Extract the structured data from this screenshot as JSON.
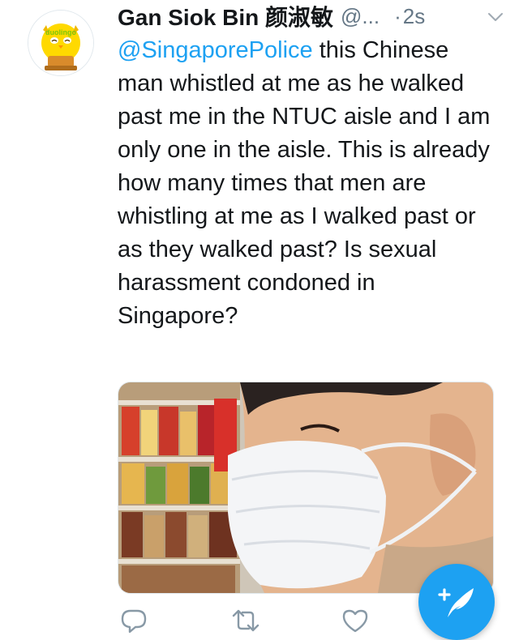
{
  "tweet": {
    "display_name": "Gan Siok Bin 颜淑敏",
    "handle": "@...",
    "dot": "·",
    "timestamp": "2s",
    "mention": "@SingaporePolice",
    "body": " this Chinese man whistled at me as he walked past me in the NTUC aisle and I am only one in the aisle. This is already how many times that men are whistling at me as I walked past or as they walked past? Is sexual harassment condoned in Singapore?"
  },
  "avatar": {
    "brand_text": "duolingo"
  },
  "icons": {
    "reply": "reply-icon",
    "retweet": "retweet-icon",
    "like": "heart-icon",
    "compose": "compose-tweet-icon",
    "caret": "chevron-down-icon"
  },
  "colors": {
    "accent": "#1da1f2",
    "secondary_text": "#657786",
    "primary_text": "#14171a",
    "duolingo_green": "#7ac70c"
  }
}
